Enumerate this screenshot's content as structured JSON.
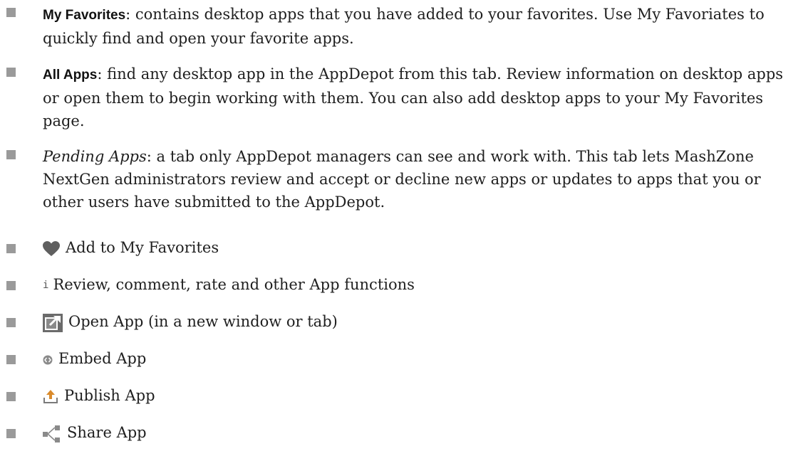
{
  "items": [
    {
      "term": "My Favorites",
      "description": ": contains desktop apps that you have added to your favorites. Use My Favoriates to quickly find and open your favorite apps."
    },
    {
      "term": "All Apps",
      "description": ": find any desktop app in the AppDepot from this tab. Review information on desktop apps or open them to begin working with them. You can also add desktop apps to your My Favorites page."
    },
    {
      "term": "Pending Apps",
      "description": ": a tab only AppDepot managers can see and work with. This tab lets MashZone NextGen administrators review and accept or decline new apps or updates to apps that you or other users have submitted to the AppDepot."
    }
  ],
  "icon_items": [
    {
      "icon": "heart-icon",
      "label": "Add to My Favorites"
    },
    {
      "icon": "info-icon",
      "glyph": "i",
      "label": "Review, comment, rate and other App functions"
    },
    {
      "icon": "open-app-icon",
      "label": "Open App (in a new window or tab)"
    },
    {
      "icon": "embed-icon",
      "label": "Embed App"
    },
    {
      "icon": "publish-icon",
      "label": "Publish App"
    },
    {
      "icon": "share-icon",
      "label": "Share App"
    }
  ],
  "colors": {
    "bullet": "#9a9a9a",
    "text": "#1f1f1f",
    "heart": "#5f5f5f",
    "publish": "#d98a2b"
  }
}
